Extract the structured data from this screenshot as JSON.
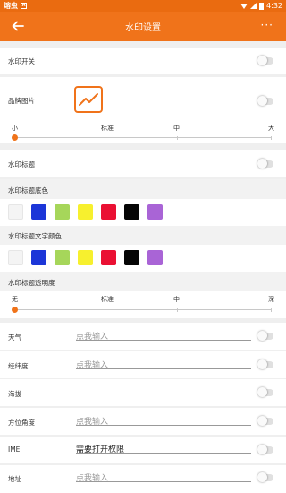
{
  "status": {
    "left_text": "熔虫",
    "time": "4:32"
  },
  "appbar": {
    "title": "水印设置",
    "more": "···"
  },
  "watermark_switch": {
    "label": "水印开关"
  },
  "brand_image": {
    "label": "品牌图片"
  },
  "size_slider": {
    "labels": [
      "小",
      "标准",
      "中",
      "大"
    ],
    "value": 0
  },
  "wm_title": {
    "label": "水印标题",
    "value": ""
  },
  "bg_color": {
    "label": "水印标题底色",
    "colors": [
      "#f4f4f4",
      "#1c36d8",
      "#a6d65a",
      "#f7f02e",
      "#ea1033",
      "#050505",
      "#a964d6"
    ]
  },
  "text_color": {
    "label": "水印标题文字颜色",
    "colors": [
      "#f4f4f4",
      "#1c36d8",
      "#a6d65a",
      "#f7f02e",
      "#ea1033",
      "#050505",
      "#a964d6"
    ]
  },
  "opacity": {
    "label": "水印标题透明度",
    "labels": [
      "无",
      "标准",
      "中",
      "深"
    ],
    "value": 0
  },
  "weather": {
    "label": "天气",
    "placeholder": "点我输入"
  },
  "latlng": {
    "label": "经纬度",
    "placeholder": "点我输入"
  },
  "altitude": {
    "label": "海拔"
  },
  "bearing": {
    "label": "方位角度",
    "placeholder": "点我输入"
  },
  "imei": {
    "label": "IMEI",
    "value": "需要打开权限"
  },
  "address": {
    "label": "地址",
    "placeholder": "点我输入"
  }
}
